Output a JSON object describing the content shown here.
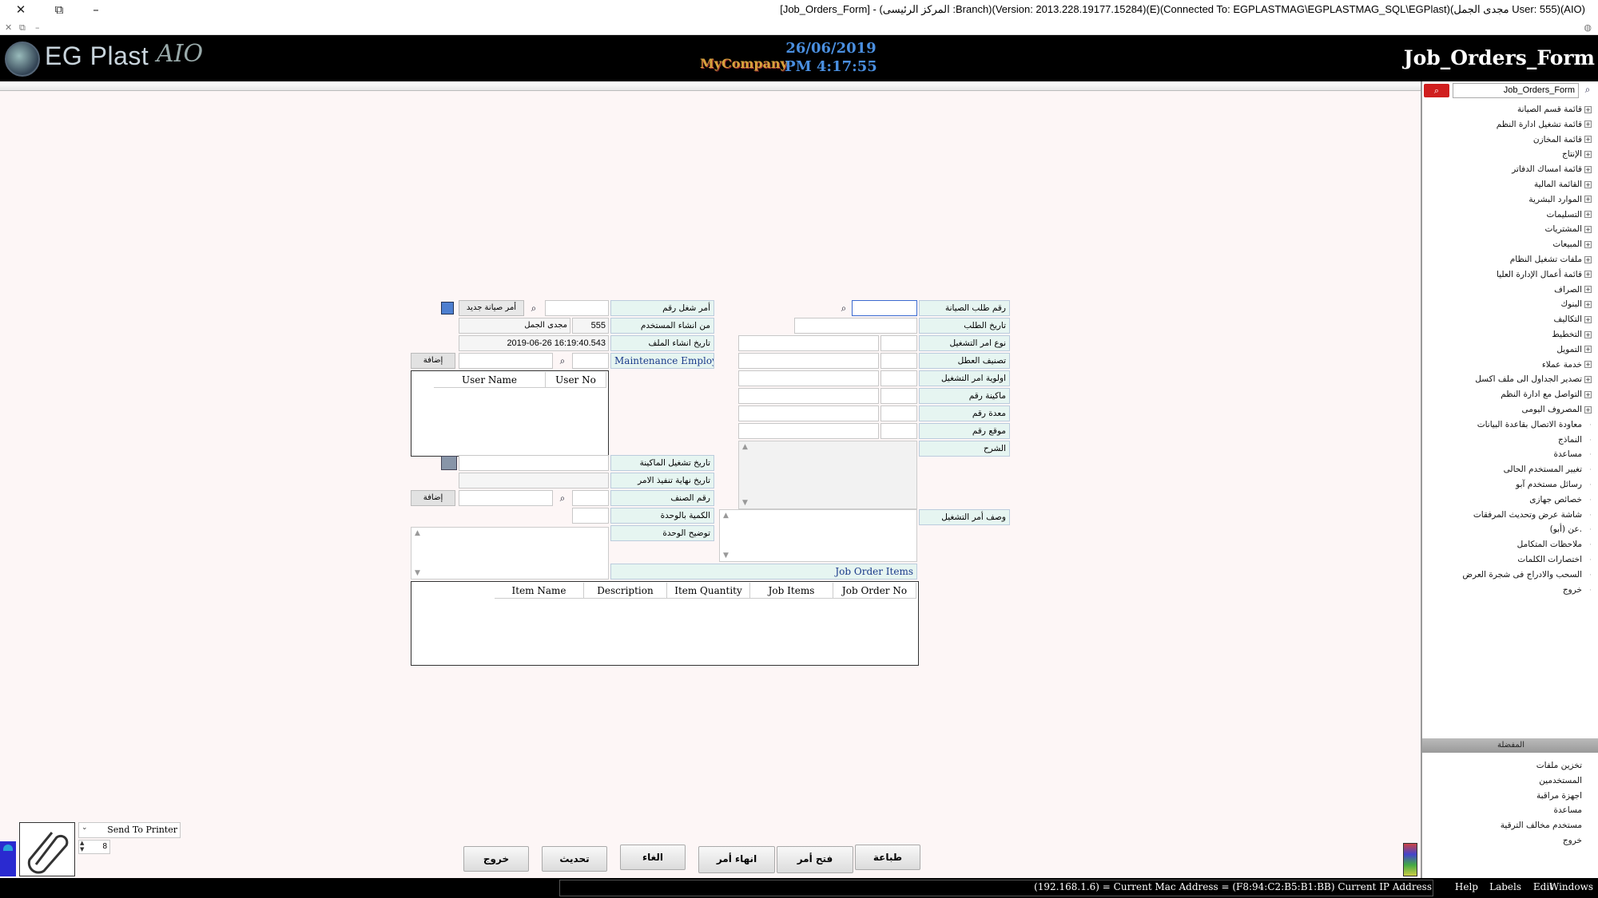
{
  "window": {
    "title": "[Job_Orders_Form] - (المركز الرئيسى :Branch)(Version: 2013.228.19177.15284)(E)(Connected To: EGPLASTMAG\\EGPLASTMAG_SQL\\EGPlast)(مجدى الجمل User: 555)(AIO)"
  },
  "header": {
    "brand": "EG Plast",
    "brand_suffix": "AIO",
    "company_logo_text": "MyCompany",
    "date": "26/06/2019",
    "time": "PM 4:17:55",
    "form_title": "Job_Orders_Form"
  },
  "right_panel": {
    "search_value": "Job_Orders_Form",
    "tree": [
      {
        "label": "قائمة قسم الصيانة",
        "expand": true
      },
      {
        "label": "قائمة تشغيل ادارة النظم",
        "expand": true
      },
      {
        "label": "قائمة المخازن",
        "expand": true
      },
      {
        "label": "الإنتاج",
        "expand": true
      },
      {
        "label": "قائمة امساك الدفاتر",
        "expand": true
      },
      {
        "label": "القائمة المالية",
        "expand": true
      },
      {
        "label": "الموارد البشرية",
        "expand": true
      },
      {
        "label": "التسليمات",
        "expand": true
      },
      {
        "label": "المشتريات",
        "expand": true
      },
      {
        "label": "المبيعات",
        "expand": true
      },
      {
        "label": "ملفات تشغيل النظام",
        "expand": true
      },
      {
        "label": "قائمة أعمال الإدارة العليا",
        "expand": true
      },
      {
        "label": "الصراف",
        "expand": true
      },
      {
        "label": "البنوك",
        "expand": true
      },
      {
        "label": "التكاليف",
        "expand": true
      },
      {
        "label": "التخطيط",
        "expand": true
      },
      {
        "label": "التمويل",
        "expand": true
      },
      {
        "label": "خدمة عملاء",
        "expand": true
      },
      {
        "label": "تصدير الجداول الى ملف اكسل",
        "expand": true
      },
      {
        "label": "التواصل مع ادارة النظم",
        "expand": true
      },
      {
        "label": "المصروف اليومى",
        "expand": true
      },
      {
        "label": "معاودة الاتصال بقاعدة البيانات",
        "expand": false
      },
      {
        "label": "النماذج",
        "expand": false
      },
      {
        "label": "مساعدة",
        "expand": false
      },
      {
        "label": "تغيير المستخدم الحالى",
        "expand": false
      },
      {
        "label": "رسائل مستخدم آبو",
        "expand": false
      },
      {
        "label": "خصائص جهازى",
        "expand": false
      },
      {
        "label": "شاشة عرض وتحديث المرفقات",
        "expand": false
      },
      {
        "label": "عن (أبو).",
        "expand": false
      },
      {
        "label": "ملاحظات المتكامل",
        "expand": false
      },
      {
        "label": "اختصارات الكلمات",
        "expand": false
      },
      {
        "label": "السحب والادراج فى شجرة العرض",
        "expand": false
      },
      {
        "label": "خروج",
        "expand": false
      }
    ],
    "favorites_title": "المفضلة",
    "favorites": [
      "تخزين ملفات",
      "المستخدمين",
      "اجهزة مراقبة",
      "مساعدة",
      "مستخدم مخالف الترقية",
      "خروج"
    ]
  },
  "form": {
    "right": {
      "maint_request_no_label": "رقم طلب الصيانة",
      "maint_request_no_value": "",
      "request_date_label": "تاريخ الطلب",
      "job_order_type_label": "نوع امر التشغيل",
      "fault_class_label": "تصنيف العطل",
      "priority_label": "اولوية امر التشغيل",
      "machine_no_label": "ماكينة رقم",
      "equipment_no_label": "معدة رقم",
      "location_no_label": "موقع رقم",
      "explanation_label": "الشرح",
      "job_desc_label": "وصف أمر التشغيل",
      "job_order_items_label": "Job Order Items"
    },
    "left": {
      "job_order_no_label": "أمر شغل رقم",
      "new_maint_order_label": "أمر صيانة جديد",
      "created_by_label": "من انشاء المستخدم",
      "user_no": "555",
      "user_name": "مجدى الجمل",
      "file_created_date_label": "تاريخ انشاء الملف",
      "file_created_date": "2019-06-26 16:19:40.543",
      "maint_employee_label": "Maintenance Employee",
      "add_label": "إضافة",
      "users_grid_cols": [
        "User No",
        "User Name"
      ],
      "machine_run_date_label": "تاريخ تشغيل الماكينة",
      "job_end_date_label": "تاريخ نهاية تنفيذ الامر",
      "item_no_label": "رقم الصنف",
      "qty_per_unit_label": "الكمية بالوحدة",
      "unit_desc_label": "توضيح الوحدة"
    },
    "items_grid_cols": [
      "Job Order No",
      "Job Items",
      "Item Quantity",
      "Description",
      "Item Name"
    ]
  },
  "footer": {
    "print_mode": "Send To Printer",
    "copies": "8",
    "buttons": {
      "print": "طباعة",
      "open_job": "فتح أمر التشغيل",
      "close_job": "انهاء أمر التشغيل",
      "cancel": "الغاء",
      "update": "تحديث",
      "exit": "خروج"
    }
  },
  "statusbar": {
    "ip_info": "(192.168.1.6) = Current Mac Address = (F8:94:C2:B5:B1:BB) Current IP Address",
    "menu": [
      "Help",
      "Labels",
      "Edit",
      "Windows"
    ]
  }
}
